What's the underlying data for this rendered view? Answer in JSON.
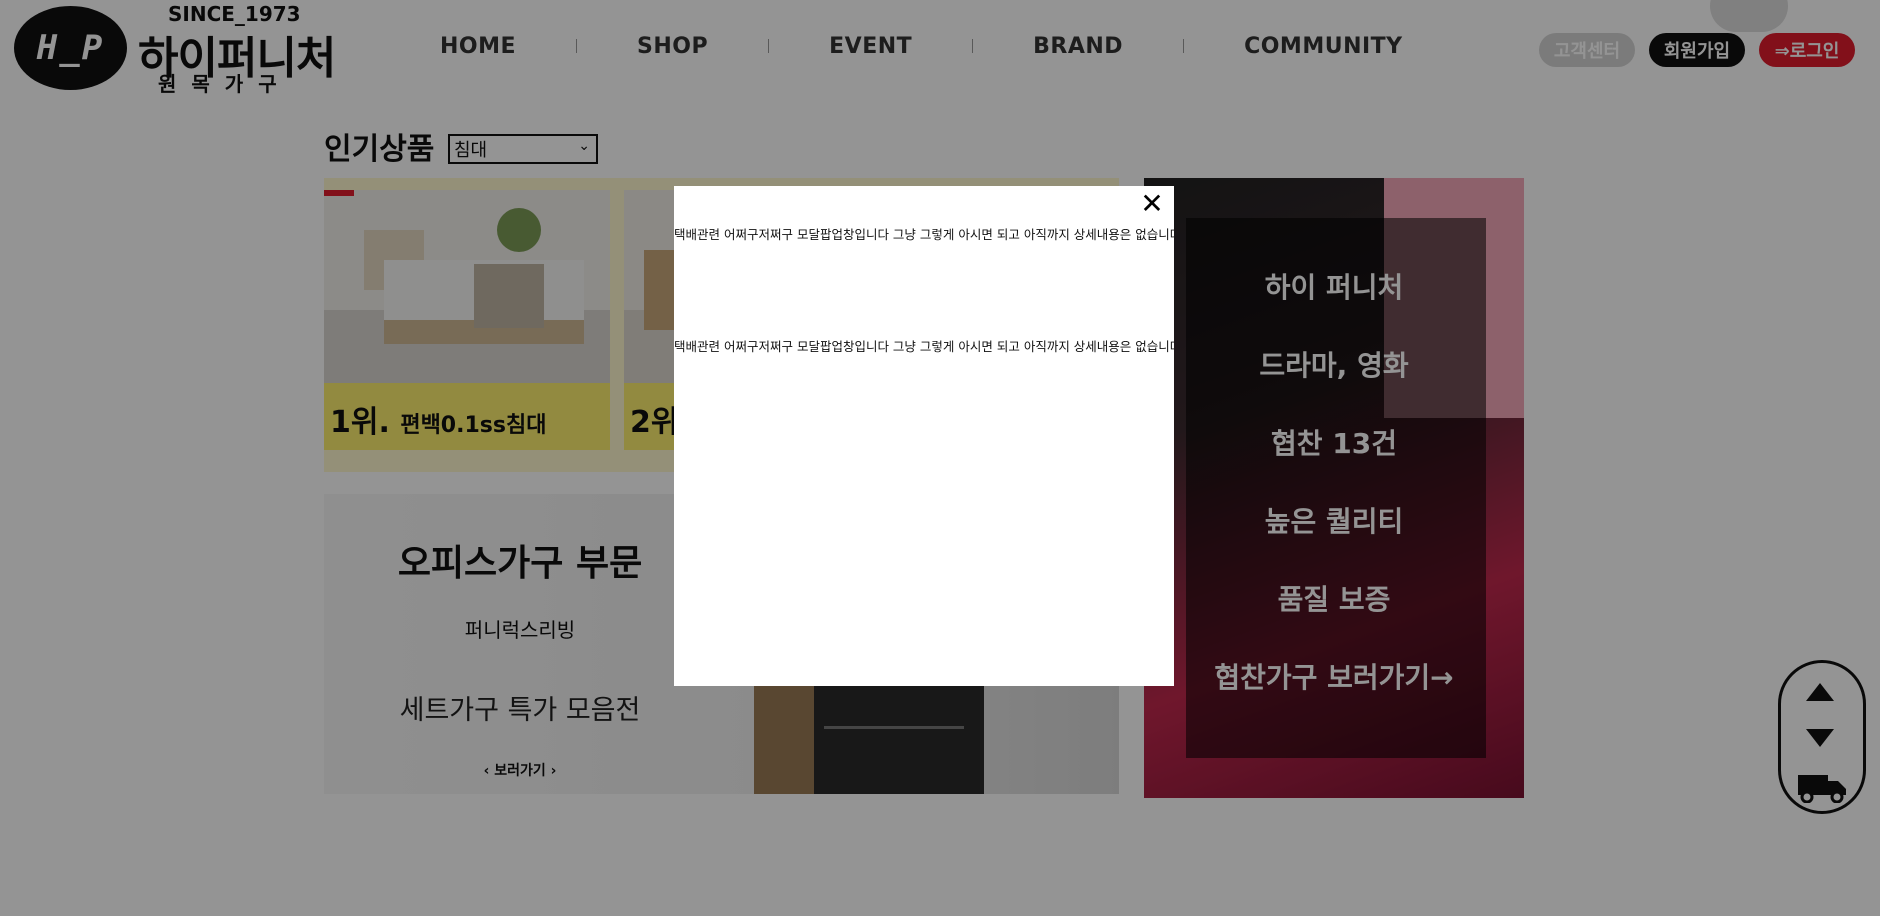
{
  "header": {
    "logo_mark": "H_P",
    "logo_since": "SINCE_1973",
    "logo_name": "하이퍼니처",
    "logo_sub": "원목가구",
    "nav": [
      "HOME",
      "SHOP",
      "EVENT",
      "BRAND",
      "COMMUNITY"
    ],
    "btn_customer_center": "고객센터",
    "btn_signup": "회원가입",
    "btn_login": "⇒로그인"
  },
  "popular": {
    "title": "인기상품",
    "select_value": "침대",
    "cards": [
      {
        "rank": "1위.",
        "name": "편백0.1ss침대"
      },
      {
        "rank": "2위.",
        "name": ""
      }
    ]
  },
  "office": {
    "title": "오피스가구 부문",
    "subtitle": "퍼니럭스리빙",
    "desc": "세트가구 특가 모음전",
    "link": "‹ 보러가기 ›"
  },
  "drama": {
    "items": [
      "하이 퍼니처",
      "드라마, 영화",
      "협찬 13건",
      "높은 퀄리티",
      "품질 보증",
      "협찬가구 보러가기→"
    ]
  },
  "modal": {
    "close_glyph": "✕",
    "text1": "택배관련 어쩌구저쩌구 모달팝업창입니다 그냥 그렇게 아시면 되고 아직까지 상세내용은 없습니다..",
    "text2": "택배관련 어쩌구저쩌구 모달팝업창입니다 그냥 그렇게 아시면 되고 아직까지 상세내용은 없습니다.."
  },
  "colors": {
    "accent_red": "#e11d2e",
    "card_yellow": "#fbee6e",
    "overlay": "rgba(0,0,0,0.42)"
  }
}
